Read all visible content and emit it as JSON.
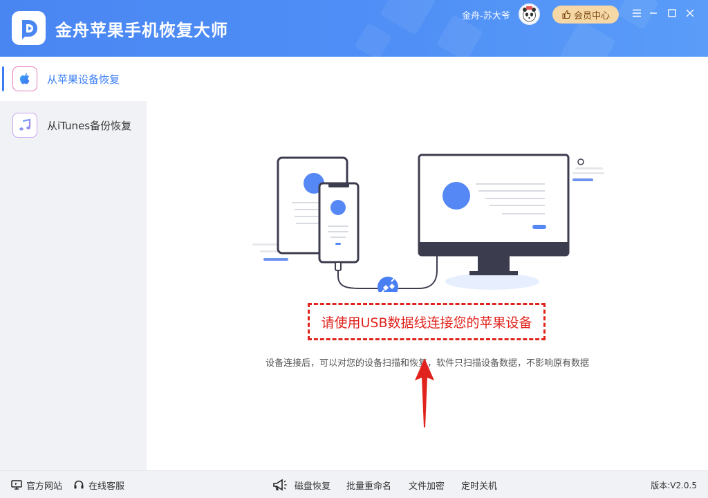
{
  "header": {
    "app_title": "金舟苹果手机恢复大师",
    "user_name": "金舟-苏大爷",
    "vip_label": "会员中心",
    "colors": {
      "header_bg": "#4f8ff6",
      "vip_bg": "#f6d7a6"
    }
  },
  "sidebar": {
    "items": [
      {
        "label": "从苹果设备恢复",
        "icon": "apple-icon",
        "active": true
      },
      {
        "label": "从iTunes备份恢复",
        "icon": "music-note-icon",
        "active": false
      }
    ]
  },
  "main": {
    "connect_prompt": "请使用USB数据线连接您的苹果设备",
    "subtext": "设备连接后，可以对您的设备扫描和恢复，软件只扫描设备数据，不影响原有数据",
    "colors": {
      "accent": "#4a86f2",
      "annotation_red": "#e0231c"
    }
  },
  "footer": {
    "left": [
      {
        "label": "官方网站",
        "icon": "monitor-icon"
      },
      {
        "label": "在线客服",
        "icon": "headset-icon"
      }
    ],
    "tools": [
      {
        "label": "磁盘恢复",
        "icon": "megaphone-icon"
      },
      {
        "label": "批量重命名"
      },
      {
        "label": "文件加密"
      },
      {
        "label": "定时关机"
      }
    ],
    "version": "版本:V2.0.5"
  }
}
